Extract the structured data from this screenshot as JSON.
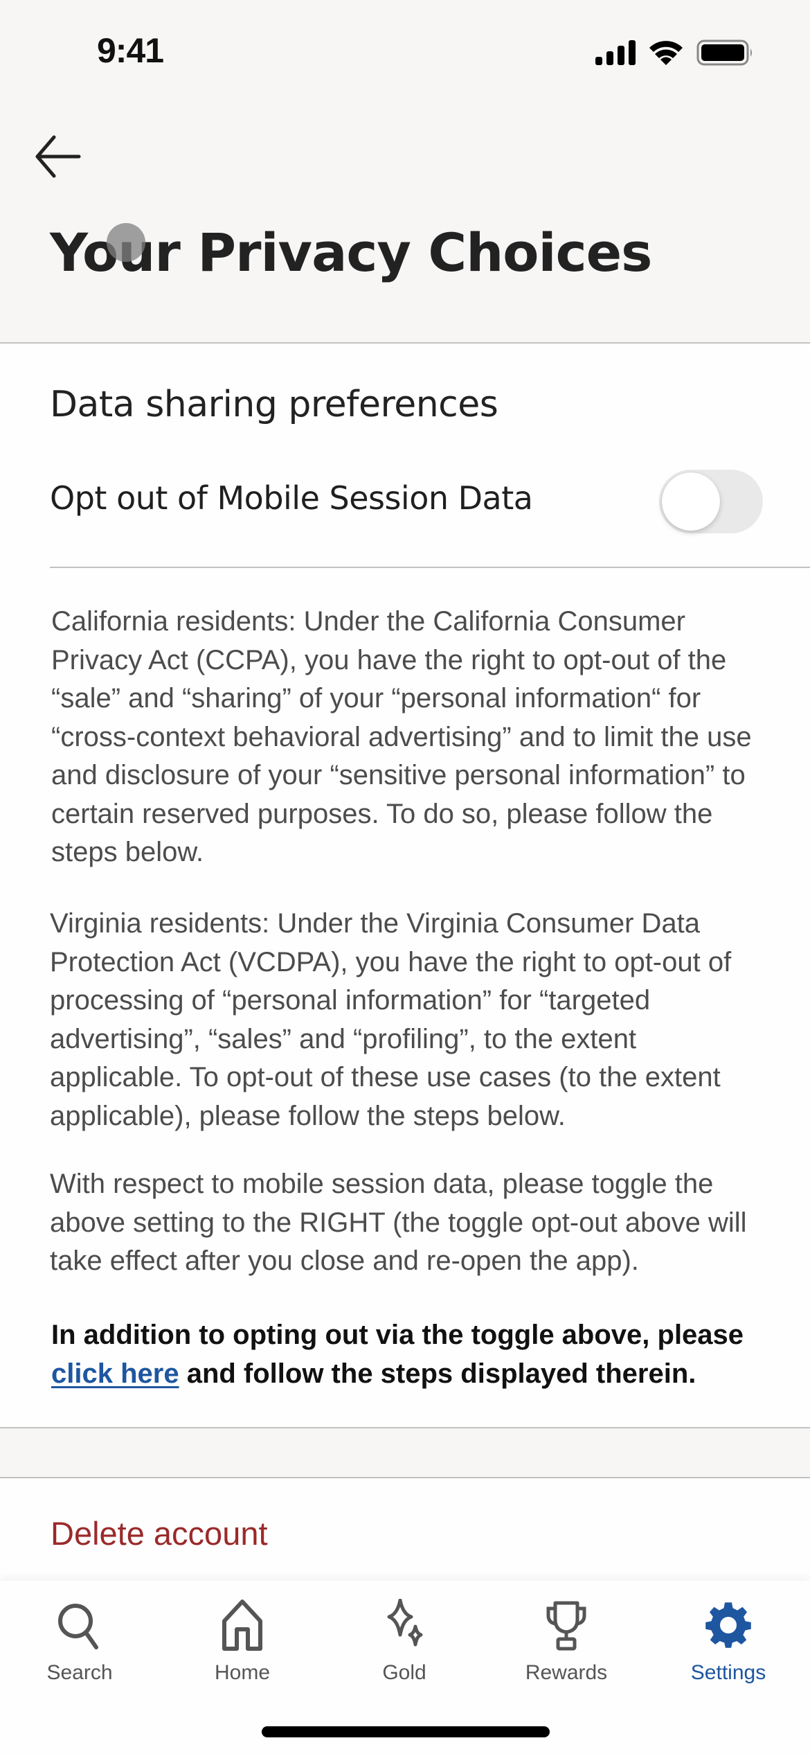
{
  "status_bar": {
    "time": "9:41",
    "icons": [
      "cellular-signal-icon",
      "wifi-icon",
      "battery-icon"
    ]
  },
  "header": {
    "back_icon": "arrow-left-icon",
    "title": "Your Privacy Choices"
  },
  "data_sharing": {
    "section_title": "Data sharing preferences",
    "toggle_label": "Opt out of Mobile Session Data",
    "toggle_on": false
  },
  "paragraphs": {
    "california": "California residents: Under the California Consumer Privacy Act (CCPA), you have the right to opt-out of the “sale” and “sharing” of your “personal information“ for “cross-context behavioral advertising” and to limit the use and disclosure of your “sensitive personal information” to certain reserved purposes. To do so, please follow the steps below.",
    "virginia": "Virginia residents: Under the Virginia Consumer Data Protection Act (VCDPA), you have the right to opt-out of processing of “personal information” for “targeted advertising”, “sales” and “profiling”, to the extent applicable. To opt-out of these use cases (to the extent applicable), please follow the steps below.",
    "mobile_session": "With respect to mobile session data, please toggle the above setting to the RIGHT (the toggle opt-out above will take effect after you close and re-open the app).",
    "additional_prefix": "In addition to opting out via the toggle above, please ",
    "additional_link": "click here",
    "additional_suffix": " and follow the steps displayed therein."
  },
  "delete_account": "Delete account",
  "tabbar": {
    "items": [
      {
        "label": "Search",
        "icon": "search-icon",
        "active": false
      },
      {
        "label": "Home",
        "icon": "home-icon",
        "active": false
      },
      {
        "label": "Gold",
        "icon": "sparkles-icon",
        "active": false
      },
      {
        "label": "Rewards",
        "icon": "trophy-icon",
        "active": false
      },
      {
        "label": "Settings",
        "icon": "gear-icon",
        "active": true
      }
    ]
  },
  "colors": {
    "accent": "#1e56a0",
    "danger": "#9a2a2a",
    "background": "#f7f6f5",
    "card": "#fefefe"
  }
}
